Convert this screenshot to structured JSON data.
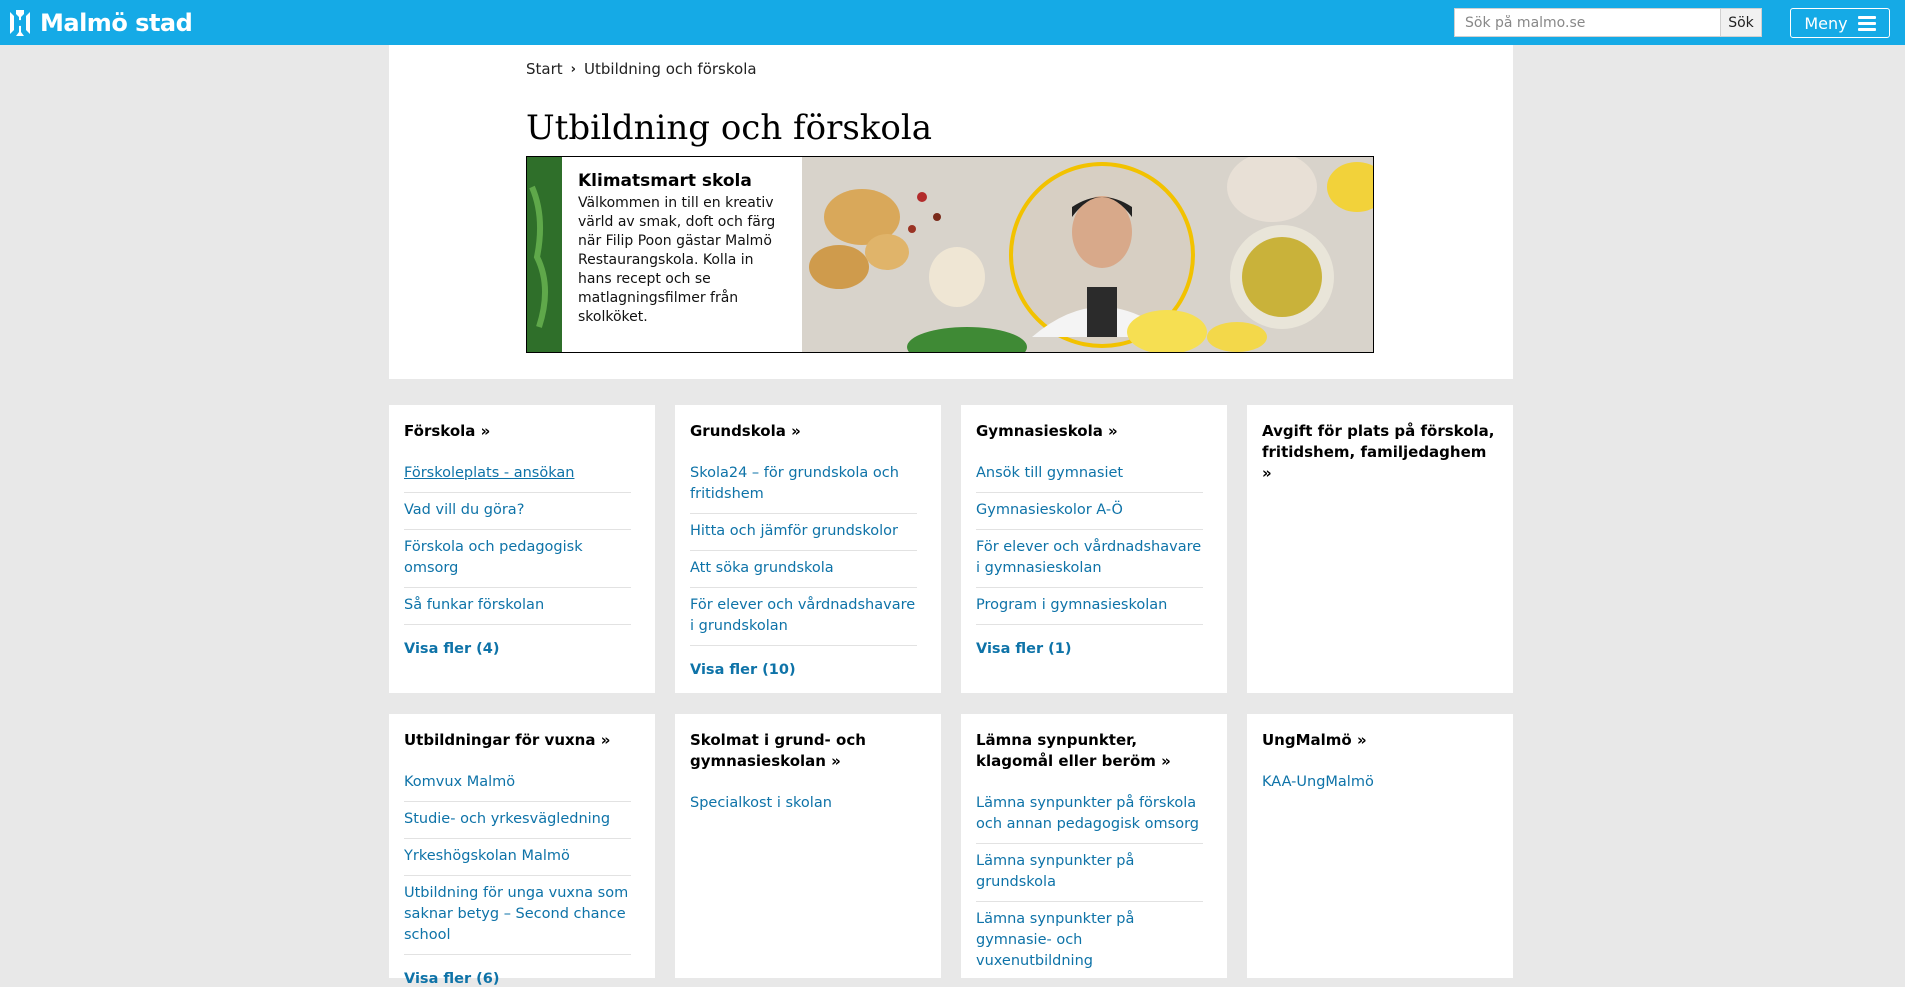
{
  "header": {
    "logo_text": "Malmö stad",
    "search_placeholder": "Sök på malmo.se",
    "search_button": "Sök",
    "menu_label": "Meny"
  },
  "breadcrumb": {
    "items": [
      "Start",
      "Utbildning och förskola"
    ]
  },
  "page_title": "Utbildning och förskola",
  "banner": {
    "title": "Klimatsmart skola",
    "text": "Välkommen in till en kreativ värld av smak, doft och färg när Filip Poon gästar Malmö Restaurangskola. Kolla in hans recept och se matlagningsfilmer från skolköket."
  },
  "cards": [
    {
      "title": "Förskola »",
      "links": [
        "Förskoleplats - ansökan",
        "Vad vill du göra?",
        "Förskola och pedagogisk omsorg",
        "Så funkar förskolan"
      ],
      "more": "Visa fler (4)"
    },
    {
      "title": "Grundskola »",
      "links": [
        "Skola24 – för grundskola och fritidshem",
        "Hitta och jämför grundskolor",
        "Att söka grundskola",
        "För elever och vårdnadshavare i grundskolan"
      ],
      "more": "Visa fler (10)"
    },
    {
      "title": "Gymnasieskola »",
      "links": [
        "Ansök till gymnasiet",
        "Gymnasieskolor A-Ö",
        "För elever och vårdnadshavare i gymnasieskolan",
        "Program i gymnasieskolan"
      ],
      "more": "Visa fler (1)"
    },
    {
      "title": "Avgift för plats på förskola, fritidshem, familjedaghem »",
      "links": [],
      "more": ""
    },
    {
      "title": "Utbildningar för vuxna »",
      "links": [
        "Komvux Malmö",
        "Studie- och yrkesvägledning",
        "Yrkeshögskolan Malmö",
        "Utbildning för unga vuxna som saknar betyg – Second chance school"
      ],
      "more": "Visa fler (6)"
    },
    {
      "title": "Skolmat i grund- och gymnasieskolan »",
      "links": [
        "Specialkost i skolan"
      ],
      "more": ""
    },
    {
      "title": "Lämna synpunkter, klagomål eller beröm »",
      "links": [
        "Lämna synpunkter på förskola och annan pedagogisk omsorg",
        "Lämna synpunkter på grundskola",
        "Lämna synpunkter på gymnasie- och vuxenutbildning"
      ],
      "more": ""
    },
    {
      "title": "UngMalmö »",
      "links": [
        "KAA-UngMalmö"
      ],
      "more": ""
    }
  ],
  "colors": {
    "header_bg": "#15aae6",
    "link": "#0e73a8",
    "page_bg": "#e8e8e8"
  }
}
